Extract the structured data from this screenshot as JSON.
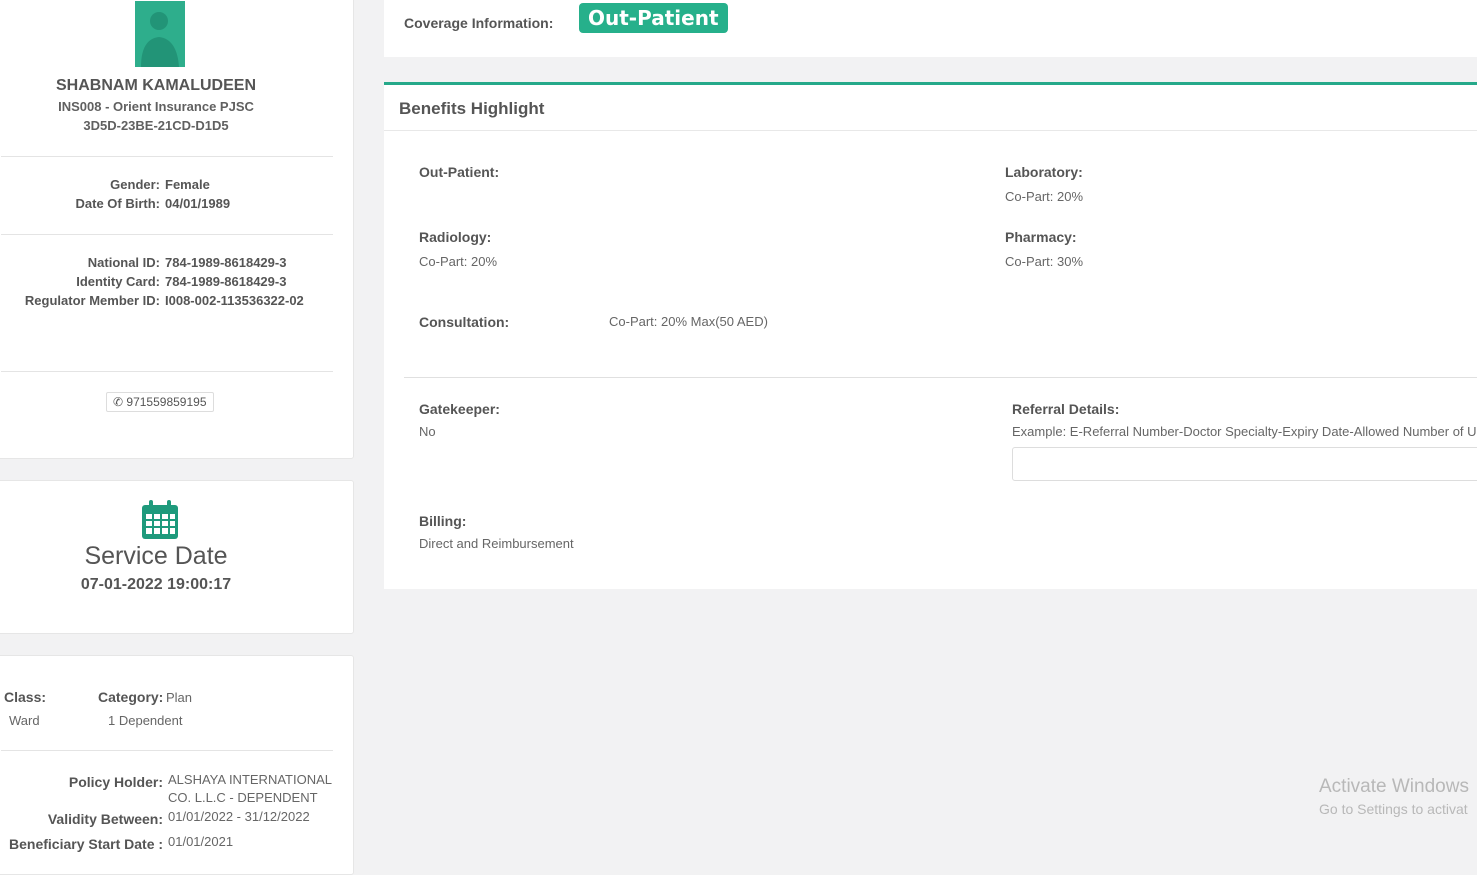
{
  "patient": {
    "name": "SHABNAM KAMALUDEEN",
    "insurer": "INS008 - Orient Insurance PJSC",
    "card_code": "3D5D-23BE-21CD-D1D5",
    "gender_label": "Gender:",
    "gender": "Female",
    "dob_label": "Date Of Birth:",
    "dob": "04/01/1989",
    "national_id_label": "National ID:",
    "national_id": "784-1989-8618429-3",
    "identity_card_label": "Identity Card:",
    "identity_card": "784-1989-8618429-3",
    "regulator_label": "Regulator Member ID:",
    "regulator_id": "I008-002-113536322-02",
    "phone": "971559859195"
  },
  "service": {
    "title": "Service Date",
    "value": "07-01-2022 19:00:17"
  },
  "policy": {
    "class_label": "Class:",
    "class": "Ward",
    "category_label": "Category:",
    "category": "Plan",
    "category_value": "1 Dependent",
    "holder_label": "Policy Holder:",
    "holder_line1": "ALSHAYA INTERNATIONAL",
    "holder_line2": "CO. L.L.C - DEPENDENT",
    "validity_label": "Validity Between:",
    "validity": "01/01/2022 - 31/12/2022",
    "start_label": "Beneficiary Start Date :",
    "start": "01/01/2021"
  },
  "coverage": {
    "label": "Coverage Information:",
    "value": "Out-Patient"
  },
  "benefits": {
    "title": "Benefits Highlight",
    "outpatient_label": "Out-Patient:",
    "laboratory_label": "Laboratory:",
    "laboratory": "Co-Part: 20%",
    "radiology_label": "Radiology:",
    "radiology": "Co-Part: 20%",
    "pharmacy_label": "Pharmacy:",
    "pharmacy": "Co-Part: 30%",
    "consultation_label": "Consultation:",
    "consultation": "Co-Part: 20% Max(50 AED)",
    "gatekeeper_label": "Gatekeeper:",
    "gatekeeper": "No",
    "referral_label": "Referral Details:",
    "referral_hint": "Example: E-Referral Number-Doctor Specialty-Expiry Date-Allowed Number of U",
    "billing_label": "Billing:",
    "billing": "Direct and Reimbursement"
  },
  "watermark": {
    "line1": "Activate Windows",
    "line2": "Go to Settings to activat"
  },
  "colors": {
    "accent": "#26b08b"
  }
}
